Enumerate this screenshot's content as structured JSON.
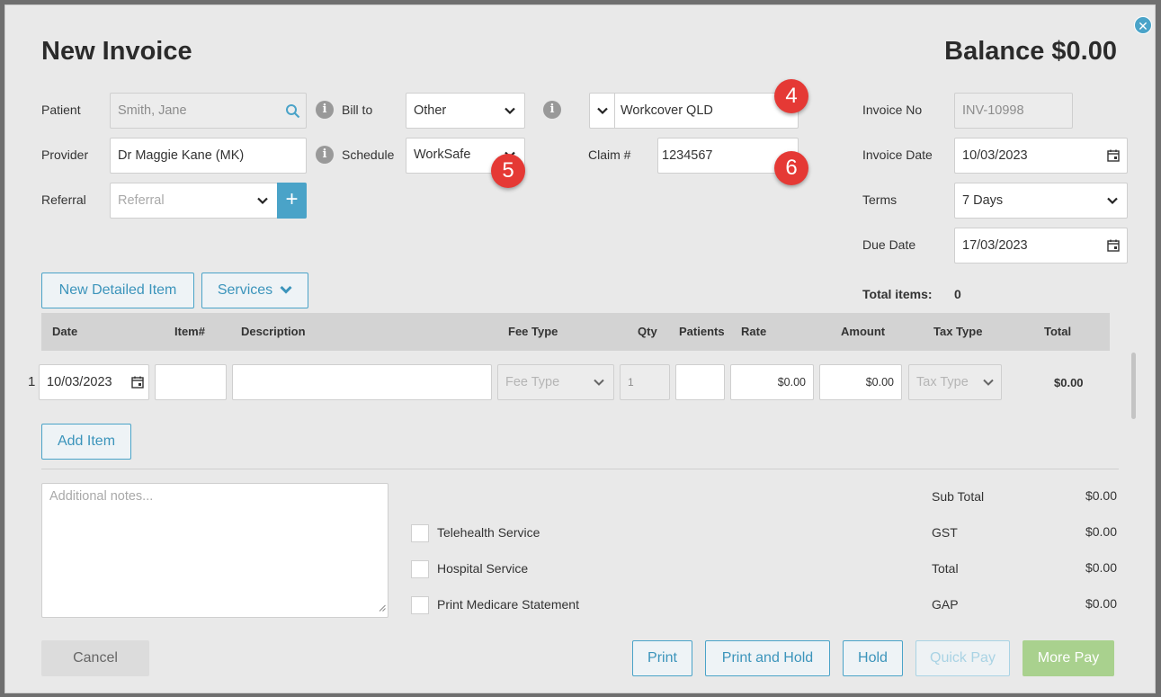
{
  "header": {
    "title": "New Invoice",
    "balance": "Balance $0.00"
  },
  "patient": {
    "label": "Patient",
    "value": "Smith, Jane"
  },
  "provider": {
    "label": "Provider",
    "value": "Dr Maggie Kane (MK)"
  },
  "referral": {
    "label": "Referral",
    "placeholder": "Referral"
  },
  "bill_to": {
    "label": "Bill to",
    "value": "Other"
  },
  "schedule": {
    "label": "Schedule",
    "value": "WorkSafe"
  },
  "payer": {
    "value": "Workcover QLD"
  },
  "claim": {
    "label": "Claim #",
    "value": "1234567"
  },
  "invoice_no": {
    "label": "Invoice No",
    "value": "INV-10998"
  },
  "invoice_date": {
    "label": "Invoice Date",
    "value": "10/03/2023"
  },
  "terms": {
    "label": "Terms",
    "value": "7 Days"
  },
  "due_date": {
    "label": "Due Date",
    "value": "17/03/2023"
  },
  "total_items": {
    "label": "Total items:",
    "value": "0"
  },
  "badges": {
    "b4": "4",
    "b5": "5",
    "b6": "6"
  },
  "buttons": {
    "new_detailed_item": "New Detailed Item",
    "services": "Services",
    "add_item": "Add Item",
    "cancel": "Cancel",
    "print": "Print",
    "print_and_hold": "Print and Hold",
    "hold": "Hold",
    "quick_pay": "Quick Pay",
    "more_pay": "More Pay"
  },
  "table": {
    "columns": [
      "Date",
      "Item#",
      "Description",
      "Fee Type",
      "Qty",
      "Patients",
      "Rate",
      "Amount",
      "Tax Type",
      "Total"
    ],
    "row": {
      "number": "1",
      "date": "10/03/2023",
      "item": "",
      "description": "",
      "fee_type_placeholder": "Fee Type",
      "qty": "1",
      "patients": "",
      "rate": "$0.00",
      "amount": "$0.00",
      "tax_type_placeholder": "Tax Type",
      "total": "$0.00"
    }
  },
  "notes": {
    "placeholder": "Additional notes..."
  },
  "checkboxes": [
    "Telehealth Service",
    "Hospital Service",
    "Print Medicare Statement"
  ],
  "summary": [
    {
      "label": "Sub Total",
      "value": "$0.00"
    },
    {
      "label": "GST",
      "value": "$0.00"
    },
    {
      "label": "Total",
      "value": "$0.00"
    },
    {
      "label": "GAP",
      "value": "$0.00"
    }
  ],
  "colors": {
    "accent": "#4aa3c8",
    "badge": "#e53935",
    "more_pay": "#a9d18e"
  }
}
